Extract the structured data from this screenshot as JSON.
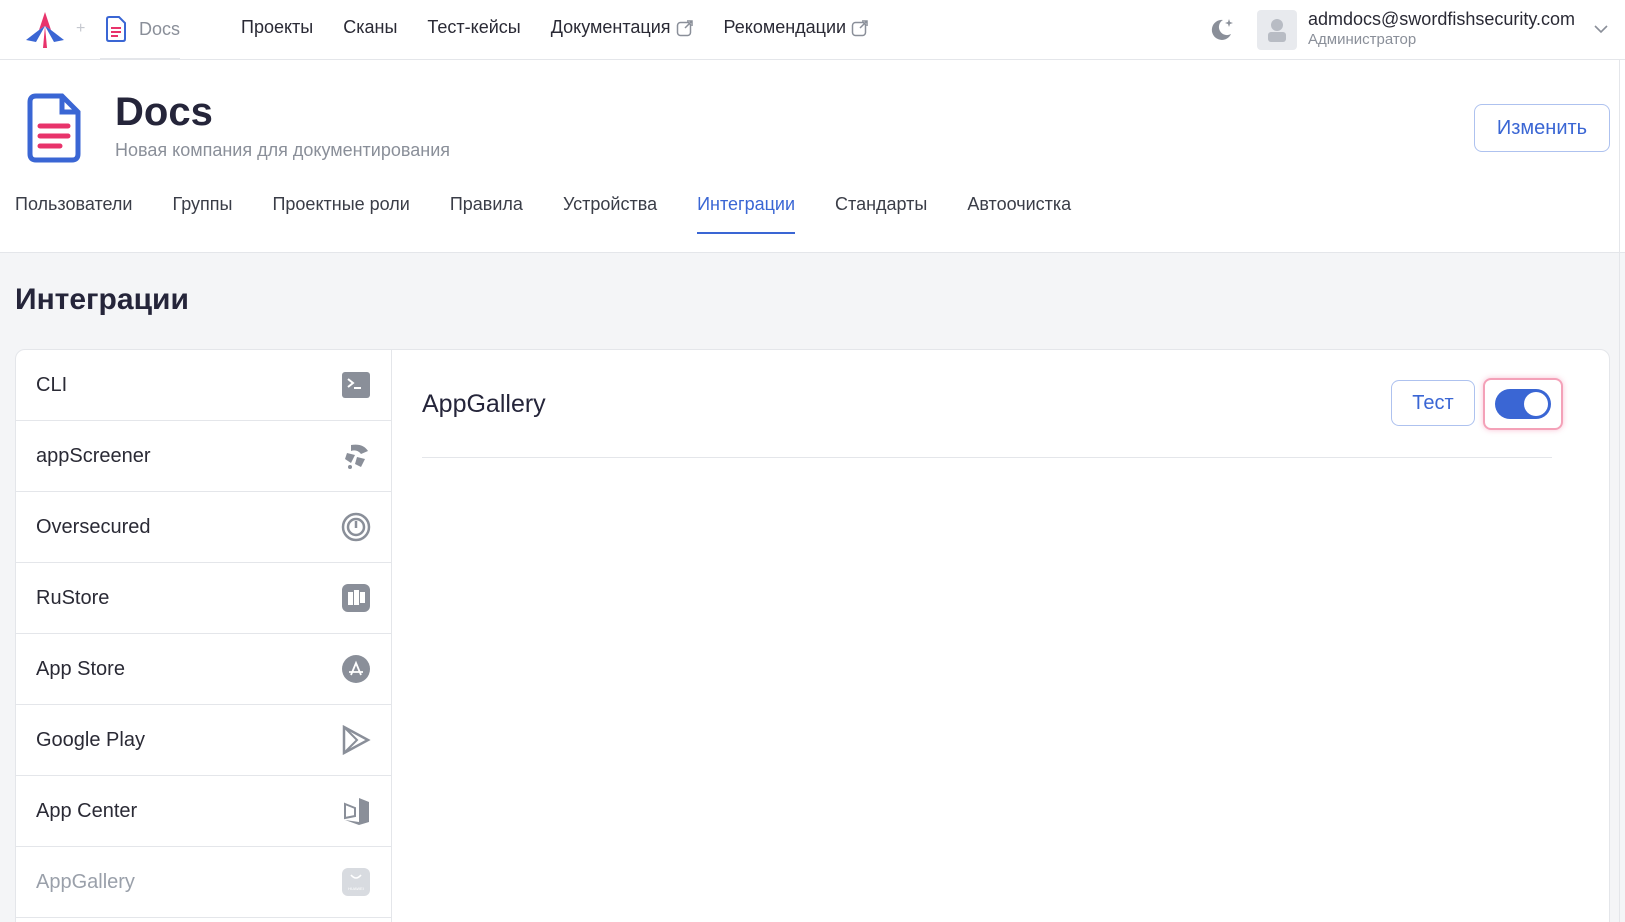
{
  "topbar": {
    "crumb": "Docs",
    "nav": [
      {
        "label": "Проекты",
        "external": false
      },
      {
        "label": "Сканы",
        "external": false
      },
      {
        "label": "Тест-кейсы",
        "external": false
      },
      {
        "label": "Документация",
        "external": true
      },
      {
        "label": "Рекомендации",
        "external": true
      }
    ],
    "user": {
      "email": "admdocs@swordfishsecurity.com",
      "role": "Администратор"
    }
  },
  "company": {
    "name": "Docs",
    "description": "Новая компания для документирования",
    "edit_label": "Изменить"
  },
  "tabs": [
    {
      "label": "Пользователи",
      "active": false
    },
    {
      "label": "Группы",
      "active": false
    },
    {
      "label": "Проектные роли",
      "active": false
    },
    {
      "label": "Правила",
      "active": false
    },
    {
      "label": "Устройства",
      "active": false
    },
    {
      "label": "Интеграции",
      "active": true
    },
    {
      "label": "Стандарты",
      "active": false
    },
    {
      "label": "Автоочистка",
      "active": false
    }
  ],
  "section_title": "Интеграции",
  "integrations": [
    {
      "label": "CLI",
      "icon": "terminal-icon"
    },
    {
      "label": "appScreener",
      "icon": "appscreener-icon"
    },
    {
      "label": "Oversecured",
      "icon": "oversecured-icon"
    },
    {
      "label": "RuStore",
      "icon": "rustore-icon"
    },
    {
      "label": "App Store",
      "icon": "app-store-icon"
    },
    {
      "label": "Google Play",
      "icon": "google-play-icon"
    },
    {
      "label": "App Center",
      "icon": "app-center-icon"
    },
    {
      "label": "AppGallery",
      "icon": "appgallery-icon",
      "selected": true
    }
  ],
  "detail": {
    "title": "AppGallery",
    "test_label": "Тест",
    "enabled": true
  },
  "colors": {
    "accent": "#3a66d4",
    "brand_pink": "#e8336b",
    "focus_ring": "#f4a1b8"
  }
}
